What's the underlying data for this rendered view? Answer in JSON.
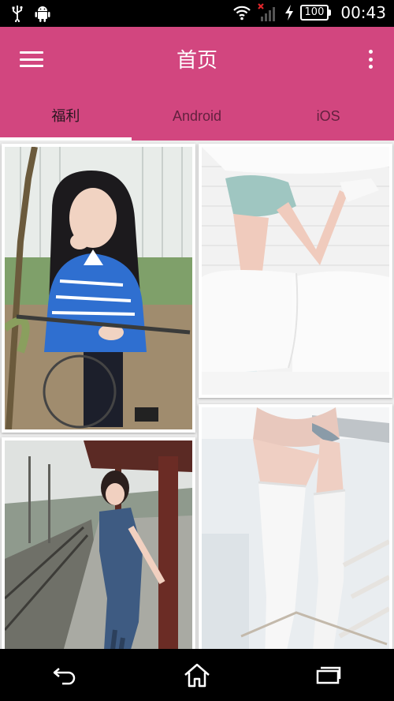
{
  "status_bar": {
    "time": "00:43",
    "battery": "100",
    "left_icons": [
      "usb-icon",
      "android-debug-icon"
    ],
    "right_icons": [
      "wifi-icon",
      "signal-no-sim-icon",
      "charging-icon"
    ]
  },
  "app_bar": {
    "title": "首页",
    "color": "#d2467f",
    "menu_icon": "hamburger-menu-icon",
    "overflow_icon": "more-vert-icon"
  },
  "tabs": [
    {
      "label": "福利",
      "active": true
    },
    {
      "label": "Android",
      "active": false
    },
    {
      "label": "iOS",
      "active": false
    }
  ],
  "photos": [
    {
      "name": "photo-girl-bicycle"
    },
    {
      "name": "photo-legs-white-sofa"
    },
    {
      "name": "photo-girl-railway-platform"
    },
    {
      "name": "photo-white-stockings"
    }
  ],
  "nav_bar": {
    "buttons": [
      "back-icon",
      "home-icon",
      "recents-icon"
    ]
  }
}
